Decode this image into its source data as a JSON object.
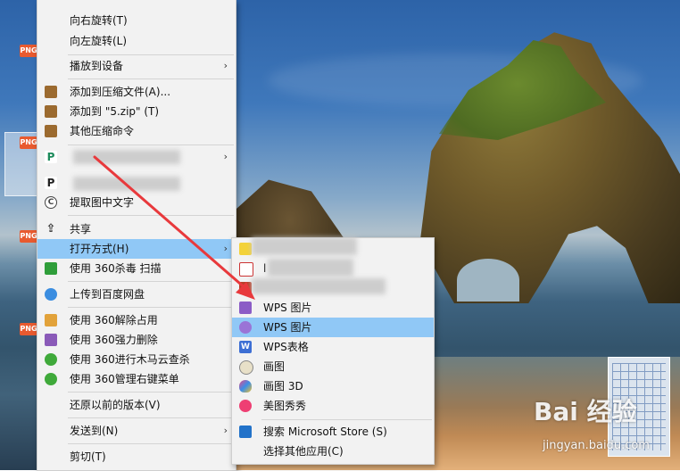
{
  "main_menu": {
    "items": [
      {
        "label": "向右旋转(T)"
      },
      {
        "label": "向左旋转(L)"
      },
      {
        "label": "播放到设备"
      },
      {
        "label": "添加到压缩文件(A)..."
      },
      {
        "label": "添加到 \"5.zip\" (T)"
      },
      {
        "label": "其他压缩命令"
      },
      {
        "label": "提取图中文字"
      },
      {
        "label": "共享"
      },
      {
        "label": "打开方式(H)"
      },
      {
        "label": "使用 360杀毒 扫描"
      },
      {
        "label": "上传到百度网盘"
      },
      {
        "label": "使用 360解除占用"
      },
      {
        "label": "使用 360强力删除"
      },
      {
        "label": "使用 360进行木马云查杀"
      },
      {
        "label": "使用 360管理右键菜单"
      },
      {
        "label": "还原以前的版本(V)"
      },
      {
        "label": "发送到(N)"
      },
      {
        "label": "剪切(T)"
      }
    ],
    "arrow_glyph": "›"
  },
  "open_with_menu": {
    "items": [
      {
        "label": "l"
      },
      {
        "label": "WPS 图片"
      },
      {
        "label": "WPS 图片"
      },
      {
        "label": "WPS表格"
      },
      {
        "label": "画图"
      },
      {
        "label": "画图 3D"
      },
      {
        "label": "美图秀秀"
      },
      {
        "label": "搜索 Microsoft Store (S)"
      },
      {
        "label": "选择其他应用(C)"
      }
    ]
  },
  "desktop": {
    "file_icon_text": "PNG"
  },
  "watermark": {
    "logo": "Bai 经验",
    "url": "jingyan.baidu.com"
  },
  "colors": {
    "menu_bg": "#f2f2f2",
    "highlight": "#90c8f6",
    "arrow_red": "#e8393c"
  }
}
